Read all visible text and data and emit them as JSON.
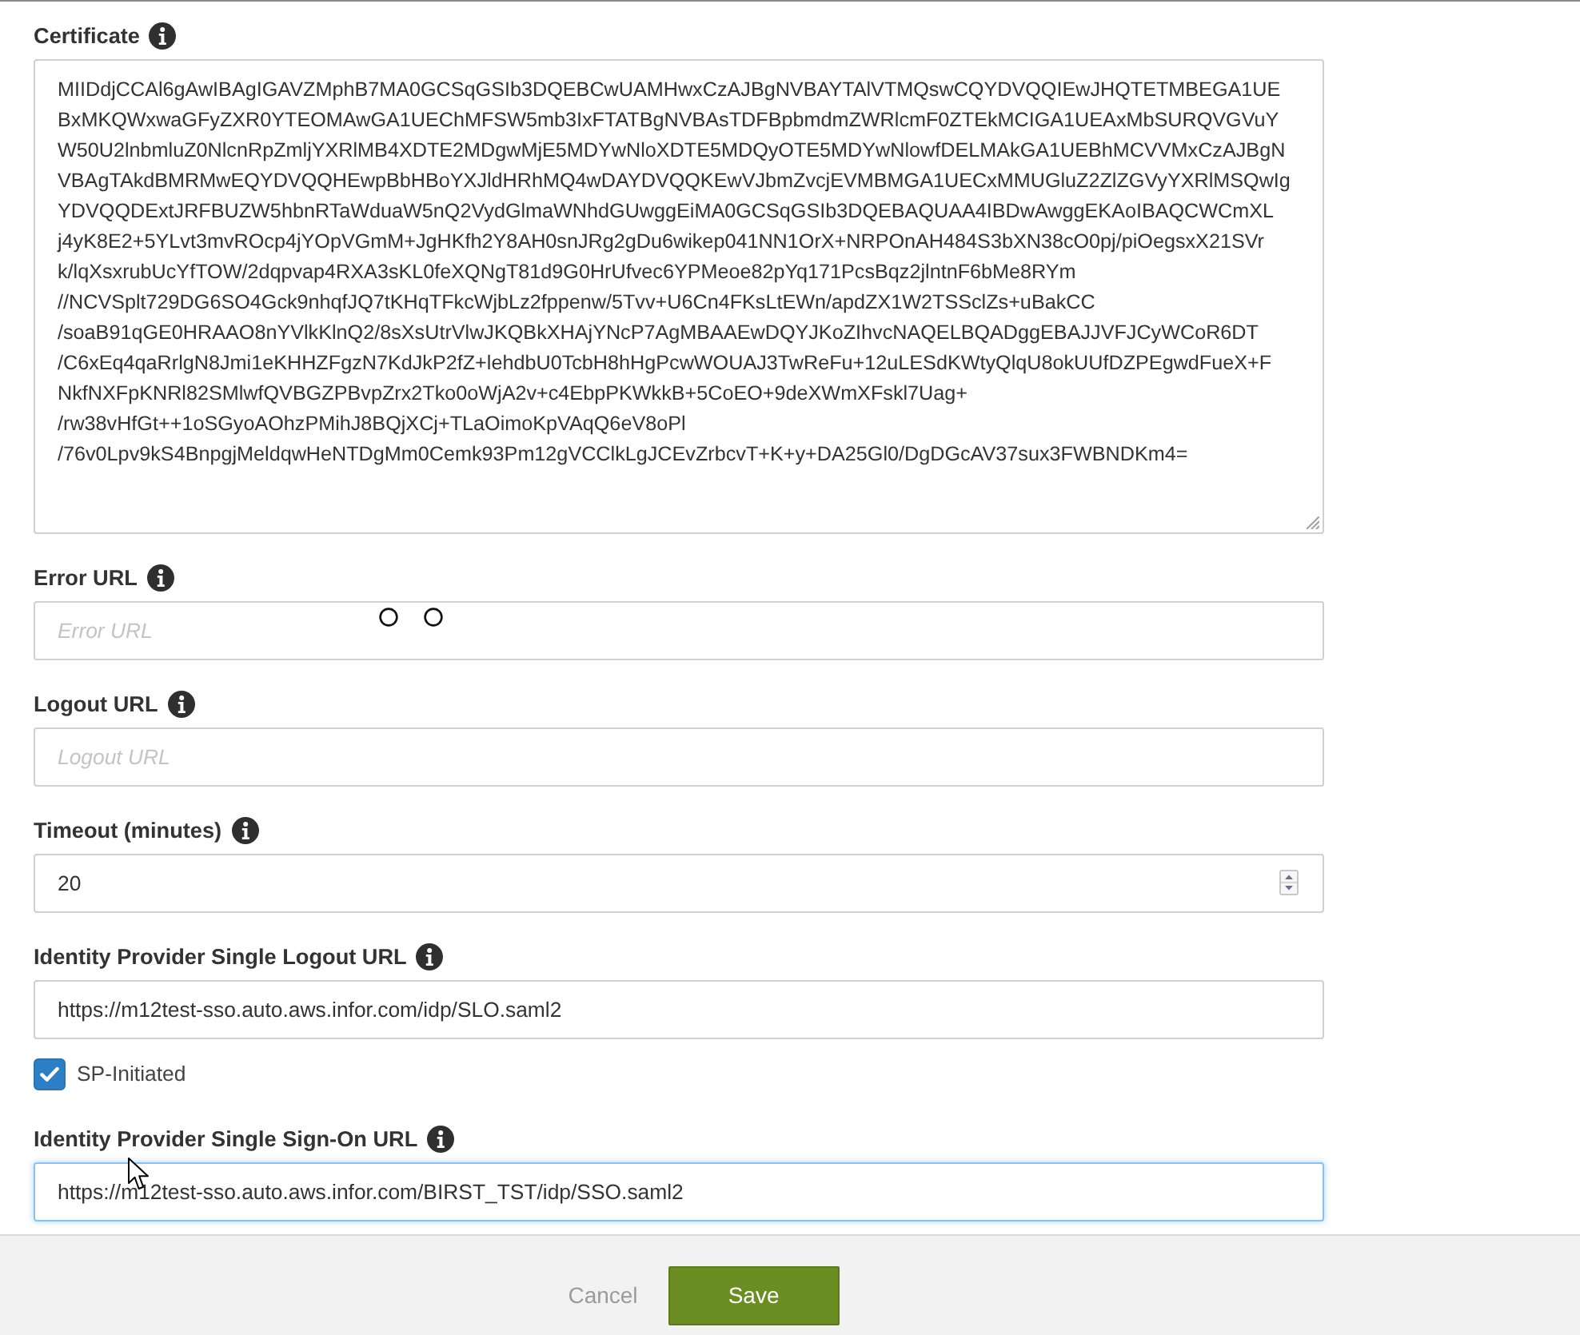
{
  "fields": [
    {
      "kind": "textarea",
      "label": "Certificate",
      "value": "MIIDdjCCAl6gAwIBAgIGAVZMphB7MA0GCSqGSIb3DQEBCwUAMHwxCzAJBgNVBAYTAlVTMQswCQYDVQQIEwJHQTETMBEGA1UE\nBxMKQWxwaGFyZXR0YTEOMAwGA1UEChMFSW5mb3IxFTATBgNVBAsTDFBpbmdmZWRlcmF0ZTEkMCIGA1UEAxMbSURQVGVuY\nW50U2lnbmluZ0NlcnRpZmljYXRlMB4XDTE2MDgwMjE5MDYwNloXDTE5MDQyOTE5MDYwNlowfDELMAkGA1UEBhMCVVMxCzAJBgN\nVBAgTAkdBMRMwEQYDVQQHEwpBbHBoYXJldHRhMQ4wDAYDVQQKEwVJbmZvcjEVMBMGA1UECxMMUGluZ2ZlZGVyYXRlMSQwIg\nYDVQQDExtJRFBUZW5hbnRTaWduaW5nQ2VydGlmaWNhdGUwggEiMA0GCSqGSIb3DQEBAQUAA4IBDwAwggEKAoIBAQCWCmXL\nj4yK8E2+5YLvt3mvROcp4jYOpVGmM+JgHKfh2Y8AH0snJRg2gDu6wikep041NN1OrX+NRPOnAH484S3bXN38cO0pj/piOegsxX21SVr\nk/lqXsxrubUcYfTOW/2dqpvap4RXA3sKL0feXQNgT81d9G0HrUfvec6YPMeoe82pYq171PcsBqz2jlntnF6bMe8RYm\n//NCVSplt729DG6SO4Gck9nhqfJQ7tKHqTFkcWjbLz2fppenw/5Tvv+U6Cn4FKsLtEWn/apdZX1W2TSSclZs+uBakCC\n/soaB91qGE0HRAAO8nYVlkKlnQ2/8sXsUtrVlwJKQBkXHAjYNcP7AgMBAAEwDQYJKoZIhvcNAQELBQADggEBAJJVFJCyWCoR6DT\n/C6xEq4qaRrlgN8Jmi1eKHHZFgzN7KdJkP2fZ+lehdbU0TcbH8hHgPcwWOUAJ3TwReFu+12uLESdKWtyQlqU8okUUfDZPEgwdFueX+F\nNkfNXFpKNRl82SMlwfQVBGZPBvpZrx2Tko0oWjA2v+c4EbpPKWkkB+5CoEO+9deXWmXFskl7Uag+\n/rw38vHfGt++1oSGyoAOhzPMihJ8BQjXCj+TLaOimoKpVAqQ6eV8oPl\n/76v0Lpv9kS4BnpgjMeldqwHeNTDgMm0Cemk93Pm12gVCClkLgJCEvZrbcvT+K+y+DA25Gl0/DgDGcAV37sux3FWBNDKm4="
    },
    {
      "kind": "text",
      "label": "Error URL",
      "placeholder": "Error URL",
      "focused": false
    },
    {
      "kind": "text",
      "label": "Logout URL",
      "placeholder": "Logout URL",
      "focused": false
    },
    {
      "kind": "number",
      "label": "Timeout (minutes)",
      "value": "20",
      "focused": false
    },
    {
      "kind": "text",
      "label": "Identity Provider Single Logout URL",
      "value": "https://m12test-sso.auto.aws.infor.com/idp/SLO.saml2",
      "focused": false
    },
    {
      "kind": "checkbox",
      "label": "SP-Initiated",
      "checked": true
    },
    {
      "kind": "text",
      "label": "Identity Provider Single Sign-On URL",
      "value": "https://m12test-sso.auto.aws.infor.com/BIRST_TST/idp/SSO.saml2",
      "focused": true
    }
  ],
  "footer": {
    "buttons": [
      {
        "kind": "link",
        "label": "Cancel"
      },
      {
        "kind": "primary",
        "label": "Save"
      }
    ]
  }
}
